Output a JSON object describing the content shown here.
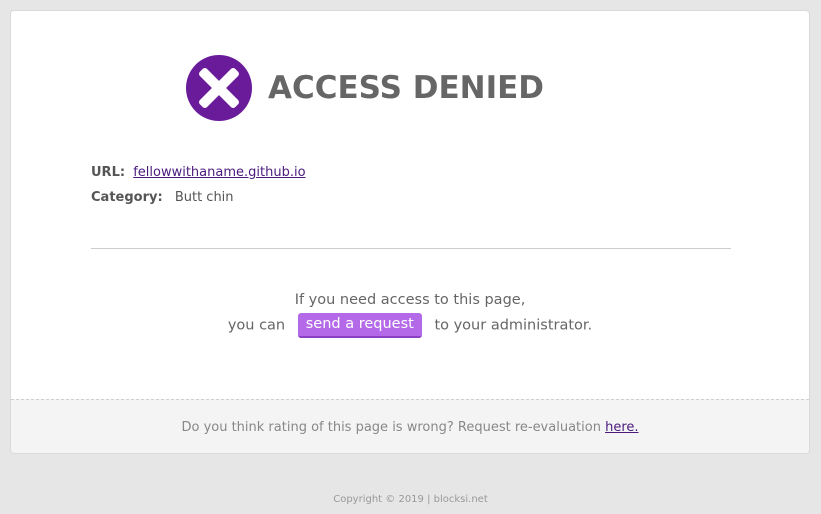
{
  "header": {
    "title": "ACCESS DENIED",
    "icon": "x-circle-icon",
    "icon_color": "#6a1b9a"
  },
  "info": {
    "url_label": "URL:",
    "url_value": "fellowwithaname.github.io",
    "category_label": "Category:",
    "category_value": "Butt chin"
  },
  "message": {
    "line1": "If you need access to this page,",
    "line2_prefix": "you can",
    "button_label": "send a request",
    "line2_suffix": "to your administrator.",
    "button_color": "#b46ae8"
  },
  "footer": {
    "question": "Do you think rating of this page is wrong? Request re-evaluation",
    "link_label": "here."
  },
  "copyright": "Copyright © 2019 | blocksi.net"
}
